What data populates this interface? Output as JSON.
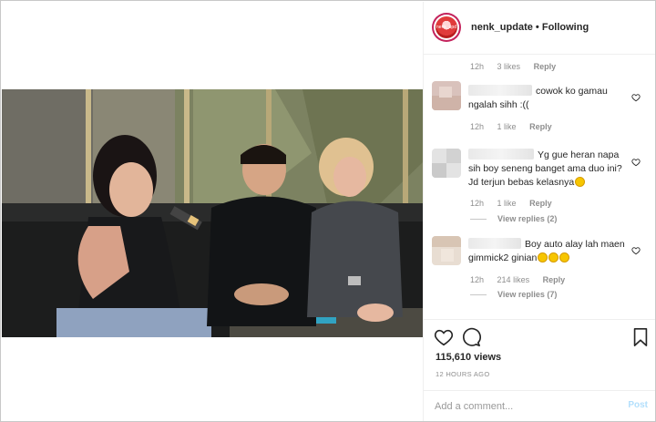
{
  "post": {
    "username": "nenk_update",
    "separator": "•",
    "follow_status": "Following",
    "avatar_caption": "nenk_upd"
  },
  "top_meta": {
    "time": "12h",
    "likes": "3 likes",
    "reply": "Reply"
  },
  "comments": [
    {
      "text": "cowok ko gamau ngalah sihh :((",
      "time": "12h",
      "likes": "1 like",
      "reply": "Reply",
      "view_replies": ""
    },
    {
      "text": "Yg gue heran napa sih boy seneng banget ama duo ini? Jd terjun bebas kelasnya",
      "time": "12h",
      "likes": "1 like",
      "reply": "Reply",
      "view_replies": "View replies (2)"
    },
    {
      "text": "Boy auto alay lah maen gimmick2 ginian",
      "time": "12h",
      "likes": "214 likes",
      "reply": "Reply",
      "view_replies": "View replies (7)"
    }
  ],
  "stats": {
    "views": "115,610 views",
    "posted": "12 HOURS AGO"
  },
  "composer": {
    "placeholder": "Add a comment...",
    "post_label": "Post"
  },
  "icons": {
    "like": "heart-icon",
    "comment": "comment-icon",
    "save": "bookmark-icon",
    "comment_like": "heart-icon"
  },
  "colors": {
    "accent": "#3897f0",
    "post_disabled": "#b2dffc",
    "muted": "#8e8e8e"
  }
}
